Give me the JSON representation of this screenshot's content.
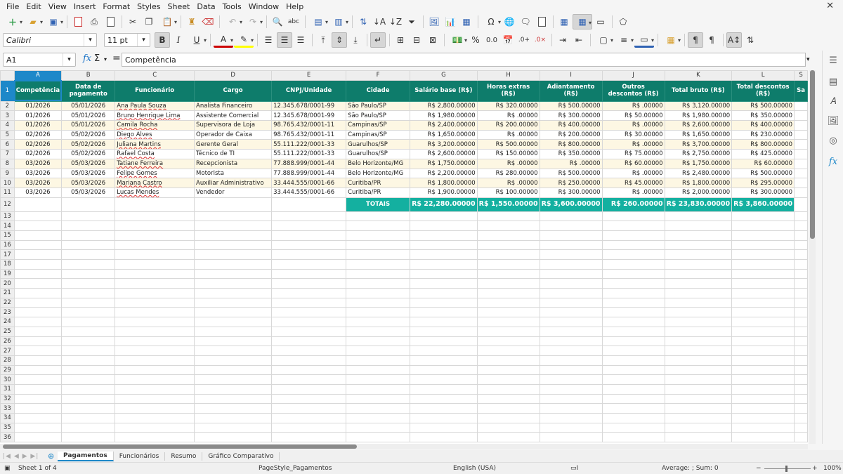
{
  "menu": [
    "File",
    "Edit",
    "View",
    "Insert",
    "Format",
    "Styles",
    "Sheet",
    "Data",
    "Tools",
    "Window",
    "Help"
  ],
  "toolbar": {
    "font_name": "Calibri",
    "font_size": "11 pt",
    "bold": "B",
    "italic": "I",
    "underline": "U"
  },
  "formula": {
    "cell_ref": "A1",
    "content": "Competência",
    "fx": "fx",
    "sigma": "Σ",
    "equals": "="
  },
  "columns": [
    "A",
    "B",
    "C",
    "D",
    "E",
    "F",
    "G",
    "H",
    "I",
    "J",
    "K",
    "L",
    "S"
  ],
  "headers": [
    "Competência",
    "Data de pagamento",
    "Funcionário",
    "Cargo",
    "CNPJ/Unidade",
    "Cidade",
    "Salário base (R$)",
    "Horas extras (R$)",
    "Adiantamento (R$)",
    "Outros descontos (R$)",
    "Total bruto (R$)",
    "Total descontos (R$)",
    "Sa"
  ],
  "rows": [
    [
      "01/2026",
      "05/01/2026",
      "Ana Paula Souza",
      "Analista Financeiro",
      "12.345.678/0001-99",
      "São Paulo/SP",
      "R$ 2,800.00000",
      "R$ 320.00000",
      "R$ 500.00000",
      "R$ .00000",
      "R$ 3,120.00000",
      "R$ 500.00000"
    ],
    [
      "01/2026",
      "05/01/2026",
      "Bruno Henrique Lima",
      "Assistente Comercial",
      "12.345.678/0001-99",
      "São Paulo/SP",
      "R$ 1,980.00000",
      "R$ .00000",
      "R$ 300.00000",
      "R$ 50.00000",
      "R$ 1,980.00000",
      "R$ 350.00000"
    ],
    [
      "01/2026",
      "05/01/2026",
      "Camila Rocha",
      "Supervisora de Loja",
      "98.765.432/0001-11",
      "Campinas/SP",
      "R$ 2,400.00000",
      "R$ 200.00000",
      "R$ 400.00000",
      "R$ .00000",
      "R$ 2,600.00000",
      "R$ 400.00000"
    ],
    [
      "02/2026",
      "05/02/2026",
      "Diego Alves",
      "Operador de Caixa",
      "98.765.432/0001-11",
      "Campinas/SP",
      "R$ 1,650.00000",
      "R$ .00000",
      "R$ 200.00000",
      "R$ 30.00000",
      "R$ 1,650.00000",
      "R$ 230.00000"
    ],
    [
      "02/2026",
      "05/02/2026",
      "Juliana Martins",
      "Gerente Geral",
      "55.111.222/0001-33",
      "Guarulhos/SP",
      "R$ 3,200.00000",
      "R$ 500.00000",
      "R$ 800.00000",
      "R$ .00000",
      "R$ 3,700.00000",
      "R$ 800.00000"
    ],
    [
      "02/2026",
      "05/02/2026",
      "Rafael Costa",
      "Técnico de TI",
      "55.111.222/0001-33",
      "Guarulhos/SP",
      "R$ 2,600.00000",
      "R$ 150.00000",
      "R$ 350.00000",
      "R$ 75.00000",
      "R$ 2,750.00000",
      "R$ 425.00000"
    ],
    [
      "03/2026",
      "05/03/2026",
      "Tatiane Ferreira",
      "Recepcionista",
      "77.888.999/0001-44",
      "Belo Horizonte/MG",
      "R$ 1,750.00000",
      "R$ .00000",
      "R$ .00000",
      "R$ 60.00000",
      "R$ 1,750.00000",
      "R$ 60.00000"
    ],
    [
      "03/2026",
      "05/03/2026",
      "Felipe Gomes",
      "Motorista",
      "77.888.999/0001-44",
      "Belo Horizonte/MG",
      "R$ 2,200.00000",
      "R$ 280.00000",
      "R$ 500.00000",
      "R$ .00000",
      "R$ 2,480.00000",
      "R$ 500.00000"
    ],
    [
      "03/2026",
      "05/03/2026",
      "Mariana Castro",
      "Auxiliar Administrativo",
      "33.444.555/0001-66",
      "Curitiba/PR",
      "R$ 1,800.00000",
      "R$ .00000",
      "R$ 250.00000",
      "R$ 45.00000",
      "R$ 1,800.00000",
      "R$ 295.00000"
    ],
    [
      "03/2026",
      "05/03/2026",
      "Lucas Mendes",
      "Vendedor",
      "33.444.555/0001-66",
      "Curitiba/PR",
      "R$ 1,900.00000",
      "R$ 100.00000",
      "R$ 300.00000",
      "R$ .00000",
      "R$ 2,000.00000",
      "R$ 300.00000"
    ]
  ],
  "totals": {
    "label": "TOTAIS",
    "values": [
      "R$ 22,280.00000",
      "R$ 1,550.00000",
      "R$ 3,600.00000",
      "R$ 260.00000",
      "R$ 23,830.00000",
      "R$ 3,860.00000"
    ]
  },
  "sheet_tabs": [
    "Pagamentos",
    "Funcionários",
    "Resumo",
    "Gráfico Comparativo"
  ],
  "active_tab": "Pagamentos",
  "status": {
    "sheet": "Sheet 1 of 4",
    "page_style": "PageStyle_Pagamentos",
    "language": "English (USA)",
    "summary": "Average: ; Sum: 0",
    "zoom": "100%",
    "zoom_minus": "−",
    "zoom_plus": "+"
  },
  "colors": {
    "header_bg": "#0e7c6b",
    "total_bg": "#14b0a0",
    "selection": "#1e88c9"
  }
}
